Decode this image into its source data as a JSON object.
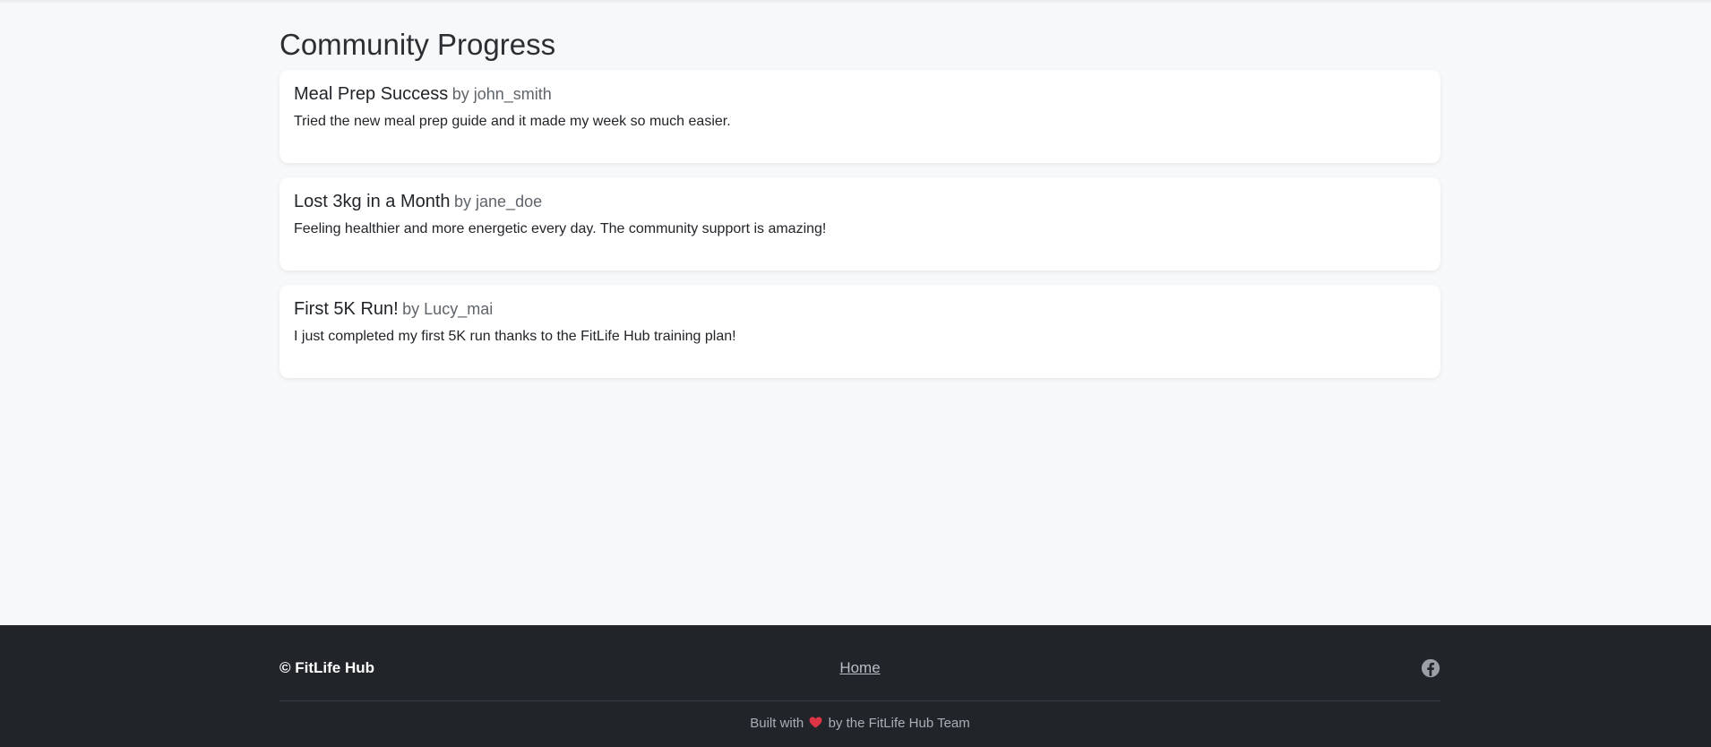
{
  "main": {
    "title": "Community Progress",
    "posts": [
      {
        "title": "Meal Prep Success",
        "author": "by john_smith",
        "body": "Tried the new meal prep guide and it made my week so much easier."
      },
      {
        "title": "Lost 3kg in a Month",
        "author": "by jane_doe",
        "body": "Feeling healthier and more energetic every day. The community support is amazing!"
      },
      {
        "title": "First 5K Run!",
        "author": "by Lucy_mai",
        "body": "I just completed my first 5K run thanks to the FitLife Hub training plan!"
      }
    ]
  },
  "footer": {
    "brand": "© FitLife Hub",
    "home_link": "Home",
    "social_icon": "facebook-icon",
    "built_prefix": "Built with",
    "built_icon": "heart-icon",
    "built_suffix": "by the FitLife Hub Team"
  },
  "colors": {
    "page_bg": "#f7f8fa",
    "card_bg": "#ffffff",
    "footer_bg": "#212429",
    "heart": "#dc3545",
    "link": "#b9bfc5"
  }
}
